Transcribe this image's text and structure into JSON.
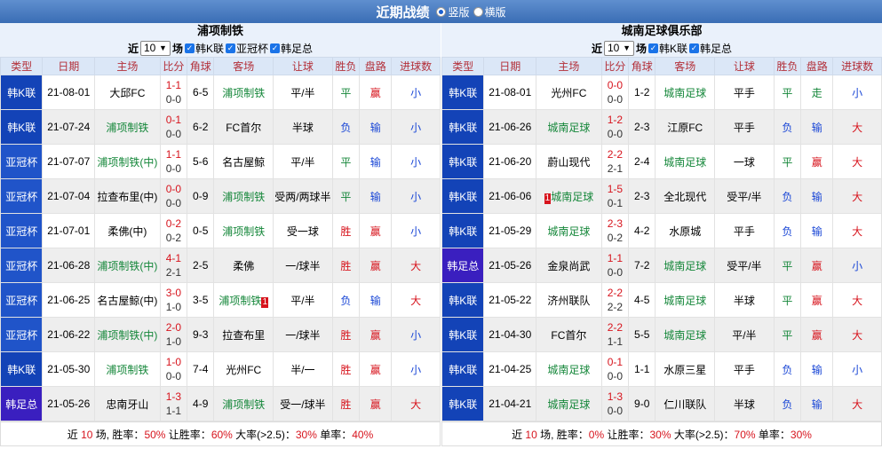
{
  "header": {
    "title": "近期战绩",
    "layout_options": [
      {
        "label": "竖版",
        "selected": true
      },
      {
        "label": "横版",
        "selected": false
      }
    ]
  },
  "columns": [
    "类型",
    "日期",
    "主场",
    "比分",
    "角球",
    "客场",
    "让球",
    "胜负",
    "盘路",
    "进球数"
  ],
  "panels": [
    {
      "team": "浦项制铁",
      "filter": {
        "prefix": "近",
        "count": "10",
        "suffix": "场",
        "options": [
          "韩K联",
          "亚冠杯",
          "韩足总"
        ]
      },
      "rows": [
        {
          "type": "韩K联",
          "date": "21-08-01",
          "home": "大邱FC",
          "full": "1-1",
          "half": "0-0",
          "corner": "6-5",
          "away": "浦项制铁",
          "handicap": "平/半",
          "result": "平",
          "cover": "赢",
          "ou": "小"
        },
        {
          "type": "韩K联",
          "date": "21-07-24",
          "home": "浦项制铁",
          "full": "0-1",
          "half": "0-0",
          "corner": "6-2",
          "away": "FC首尔",
          "handicap": "半球",
          "result": "负",
          "cover": "输",
          "ou": "小"
        },
        {
          "type": "亚冠杯",
          "date": "21-07-07",
          "home": "浦项制铁(中)",
          "full": "1-1",
          "half": "0-0",
          "corner": "5-6",
          "away": "名古屋鲸",
          "handicap": "平/半",
          "result": "平",
          "cover": "输",
          "ou": "小"
        },
        {
          "type": "亚冠杯",
          "date": "21-07-04",
          "home": "拉查布里(中)",
          "full": "0-0",
          "half": "0-0",
          "corner": "0-9",
          "away": "浦项制铁",
          "handicap": "受两/两球半",
          "result": "平",
          "cover": "输",
          "ou": "小"
        },
        {
          "type": "亚冠杯",
          "date": "21-07-01",
          "home": "柔佛(中)",
          "full": "0-2",
          "half": "0-2",
          "corner": "0-5",
          "away": "浦项制铁",
          "handicap": "受一球",
          "result": "胜",
          "cover": "赢",
          "ou": "小"
        },
        {
          "type": "亚冠杯",
          "date": "21-06-28",
          "home": "浦项制铁(中)",
          "full": "4-1",
          "half": "2-1",
          "corner": "2-5",
          "away": "柔佛",
          "handicap": "一/球半",
          "result": "胜",
          "cover": "赢",
          "ou": "大"
        },
        {
          "type": "亚冠杯",
          "date": "21-06-25",
          "home": "名古屋鲸(中)",
          "full": "3-0",
          "half": "1-0",
          "corner": "3-5",
          "away": "浦项制铁",
          "away_tag": "1",
          "handicap": "平/半",
          "result": "负",
          "cover": "输",
          "ou": "大"
        },
        {
          "type": "亚冠杯",
          "date": "21-06-22",
          "home": "浦项制铁(中)",
          "full": "2-0",
          "half": "1-0",
          "corner": "9-3",
          "away": "拉查布里",
          "handicap": "一/球半",
          "result": "胜",
          "cover": "赢",
          "ou": "小"
        },
        {
          "type": "韩K联",
          "date": "21-05-30",
          "home": "浦项制铁",
          "full": "1-0",
          "half": "0-0",
          "corner": "7-4",
          "away": "光州FC",
          "handicap": "半/一",
          "result": "胜",
          "cover": "赢",
          "ou": "小"
        },
        {
          "type": "韩足总",
          "date": "21-05-26",
          "home": "忠南牙山",
          "full": "1-3",
          "half": "1-1",
          "corner": "4-9",
          "away": "浦项制铁",
          "handicap": "受一/球半",
          "result": "胜",
          "cover": "赢",
          "ou": "大"
        }
      ],
      "summary": {
        "t1": "近 ",
        "n1": "10",
        "t2": " 场, 胜率：",
        "n2": "50%",
        "t3": " 让胜率：",
        "n3": "60%",
        "t4": " 大率(>2.5)：",
        "n4": "30%",
        "t5": " 单率：",
        "n5": "40%"
      }
    },
    {
      "team": "城南足球俱乐部",
      "filter": {
        "prefix": "近",
        "count": "10",
        "suffix": "场",
        "options": [
          "韩K联",
          "韩足总"
        ]
      },
      "rows": [
        {
          "type": "韩K联",
          "date": "21-08-01",
          "home": "光州FC",
          "full": "0-0",
          "half": "0-0",
          "corner": "1-2",
          "away": "城南足球",
          "handicap": "平手",
          "result": "平",
          "cover": "走",
          "ou": "小"
        },
        {
          "type": "韩K联",
          "date": "21-06-26",
          "home": "城南足球",
          "full": "1-2",
          "half": "0-0",
          "corner": "2-3",
          "away": "江原FC",
          "handicap": "平手",
          "result": "负",
          "cover": "输",
          "ou": "大"
        },
        {
          "type": "韩K联",
          "date": "21-06-20",
          "home": "蔚山现代",
          "full": "2-2",
          "half": "2-1",
          "corner": "2-4",
          "away": "城南足球",
          "handicap": "一球",
          "result": "平",
          "cover": "赢",
          "ou": "大"
        },
        {
          "type": "韩K联",
          "date": "21-06-06",
          "home": "城南足球",
          "home_tag": "1",
          "full": "1-5",
          "half": "0-1",
          "corner": "2-3",
          "away": "全北现代",
          "handicap": "受平/半",
          "result": "负",
          "cover": "输",
          "ou": "大"
        },
        {
          "type": "韩K联",
          "date": "21-05-29",
          "home": "城南足球",
          "full": "2-3",
          "half": "0-2",
          "corner": "4-2",
          "away": "水原城",
          "handicap": "平手",
          "result": "负",
          "cover": "输",
          "ou": "大"
        },
        {
          "type": "韩足总",
          "date": "21-05-26",
          "home": "金泉尚武",
          "full": "1-1",
          "half": "0-0",
          "corner": "7-2",
          "away": "城南足球",
          "handicap": "受平/半",
          "result": "平",
          "cover": "赢",
          "ou": "小"
        },
        {
          "type": "韩K联",
          "date": "21-05-22",
          "home": "济州联队",
          "full": "2-2",
          "half": "2-2",
          "corner": "4-5",
          "away": "城南足球",
          "handicap": "半球",
          "result": "平",
          "cover": "赢",
          "ou": "大"
        },
        {
          "type": "韩K联",
          "date": "21-04-30",
          "home": "FC首尔",
          "full": "2-2",
          "half": "1-1",
          "corner": "5-5",
          "away": "城南足球",
          "handicap": "平/半",
          "result": "平",
          "cover": "赢",
          "ou": "大"
        },
        {
          "type": "韩K联",
          "date": "21-04-25",
          "home": "城南足球",
          "full": "0-1",
          "half": "0-0",
          "corner": "1-1",
          "away": "水原三星",
          "handicap": "平手",
          "result": "负",
          "cover": "输",
          "ou": "小"
        },
        {
          "type": "韩K联",
          "date": "21-04-21",
          "home": "城南足球",
          "full": "1-3",
          "half": "0-0",
          "corner": "9-0",
          "away": "仁川联队",
          "handicap": "半球",
          "result": "负",
          "cover": "输",
          "ou": "大"
        }
      ],
      "summary": {
        "t1": "近 ",
        "n1": "10",
        "t2": " 场, 胜率：",
        "n2": "0%",
        "t3": " 让胜率：",
        "n3": "30%",
        "t4": " 大率(>2.5)：",
        "n4": "70%",
        "t5": " 单率：",
        "n5": "30%"
      }
    }
  ]
}
